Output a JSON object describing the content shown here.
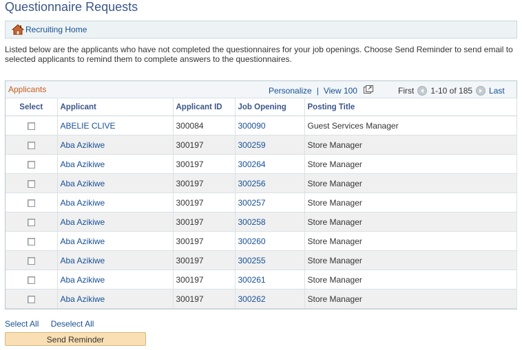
{
  "page": {
    "title": "Questionnaire Requests"
  },
  "breadcrumb": {
    "home_label": "Recruiting Home"
  },
  "intro_text": "Listed below are the applicants who have not completed the questionnaires for your job openings.  Choose Send Reminder to send email to selected applicants to remind them to complete answers to the questionnaires.",
  "grid": {
    "title": "Applicants",
    "personalize": "Personalize",
    "view_all": "View 100",
    "first": "First",
    "range": "1-10 of 185",
    "last": "Last",
    "columns": [
      "Select",
      "Applicant",
      "Applicant ID",
      "Job Opening",
      "Posting Title"
    ],
    "rows": [
      {
        "applicant": "ABELIE CLIVE",
        "applicant_id": "300084",
        "job_opening": "300090",
        "posting_title": "Guest Services Manager",
        "selected": false
      },
      {
        "applicant": "Aba Azikiwe",
        "applicant_id": "300197",
        "job_opening": "300259",
        "posting_title": "Store Manager",
        "selected": false
      },
      {
        "applicant": "Aba Azikiwe",
        "applicant_id": "300197",
        "job_opening": "300264",
        "posting_title": "Store Manager",
        "selected": false
      },
      {
        "applicant": "Aba Azikiwe",
        "applicant_id": "300197",
        "job_opening": "300256",
        "posting_title": "Store Manager",
        "selected": false
      },
      {
        "applicant": "Aba Azikiwe",
        "applicant_id": "300197",
        "job_opening": "300257",
        "posting_title": "Store Manager",
        "selected": false
      },
      {
        "applicant": "Aba Azikiwe",
        "applicant_id": "300197",
        "job_opening": "300258",
        "posting_title": "Store Manager",
        "selected": false
      },
      {
        "applicant": "Aba Azikiwe",
        "applicant_id": "300197",
        "job_opening": "300260",
        "posting_title": "Store Manager",
        "selected": false
      },
      {
        "applicant": "Aba Azikiwe",
        "applicant_id": "300197",
        "job_opening": "300255",
        "posting_title": "Store Manager",
        "selected": false
      },
      {
        "applicant": "Aba Azikiwe",
        "applicant_id": "300197",
        "job_opening": "300261",
        "posting_title": "Store Manager",
        "selected": false
      },
      {
        "applicant": "Aba Azikiwe",
        "applicant_id": "300197",
        "job_opening": "300262",
        "posting_title": "Store Manager",
        "selected": false
      }
    ]
  },
  "actions": {
    "select_all": "Select All",
    "deselect_all": "Deselect All",
    "send_reminder": "Send Reminder"
  },
  "icons": {
    "home": "home-icon",
    "zoom": "zoom-grid-icon",
    "prev": "previous-arrow-icon",
    "next": "next-arrow-icon"
  },
  "colors": {
    "title": "#3b5689",
    "link": "#164f96",
    "grid_title": "#c95b1a",
    "button_bg": "#f9dfb3"
  }
}
